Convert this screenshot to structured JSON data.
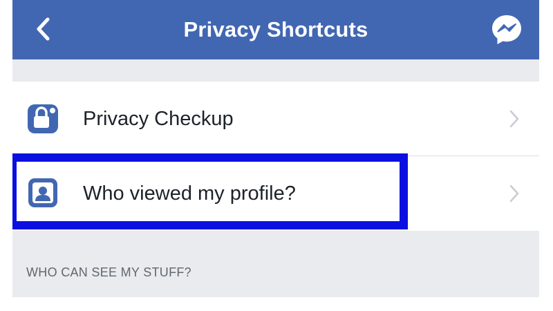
{
  "header": {
    "title": "Privacy Shortcuts",
    "back_icon": "chevron-left-icon",
    "messenger_icon": "messenger-icon",
    "bar_color": "#4267b2"
  },
  "items": [
    {
      "label": "Privacy Checkup",
      "icon": "lock-icon"
    },
    {
      "label": "Who viewed my profile?",
      "icon": "profile-icon"
    }
  ],
  "section": {
    "header": "WHO CAN SEE MY STUFF?"
  },
  "colors": {
    "background": "#e9ebee",
    "highlight": "#0b10e0",
    "icon_accent": "#4267b2"
  }
}
